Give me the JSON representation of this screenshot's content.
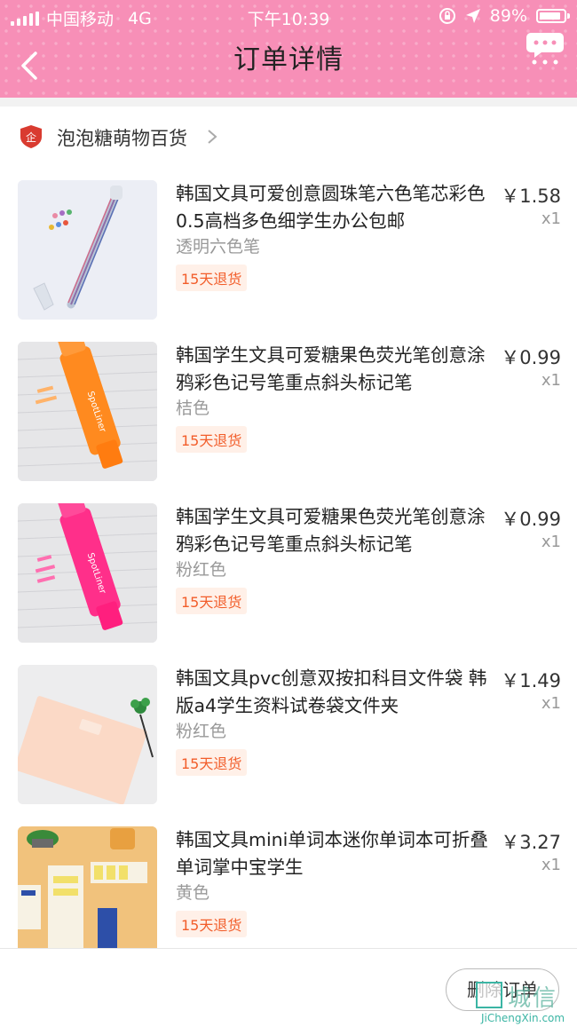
{
  "status_bar": {
    "carrier": "中国移动",
    "network": "4G",
    "time": "下午10:39",
    "battery": "89%",
    "battery_level": 0.89
  },
  "nav": {
    "title": "订单详情",
    "back_icon": "chevron-left-icon",
    "more_icon": "chat-bubble-more-icon"
  },
  "shop": {
    "name": "泡泡糖萌物百货",
    "icon": "shop-shield-icon"
  },
  "items": [
    {
      "title": "韩国文具可爱创意圆珠笔六色笔芯彩色0.5高档多色细学生办公包邮",
      "sku": "透明六色笔",
      "tag": "15天退货",
      "price": "￥1.58",
      "qty": "x1"
    },
    {
      "title": "韩国学生文具可爱糖果色荧光笔创意涂鸦彩色记号笔重点斜头标记笔",
      "sku": "桔色",
      "tag": "15天退货",
      "price": "￥0.99",
      "qty": "x1"
    },
    {
      "title": "韩国学生文具可爱糖果色荧光笔创意涂鸦彩色记号笔重点斜头标记笔",
      "sku": "粉红色",
      "tag": "15天退货",
      "price": "￥0.99",
      "qty": "x1"
    },
    {
      "title": "韩国文具pvc创意双按扣科目文件袋 韩版a4学生资料试卷袋文件夹",
      "sku": "粉红色",
      "tag": "15天退货",
      "price": "￥1.49",
      "qty": "x1"
    },
    {
      "title": "韩国文具mini单词本迷你单词本可折叠单词掌中宝学生",
      "sku": "黄色",
      "tag": "15天退货",
      "price": "￥3.27",
      "qty": "x1"
    }
  ],
  "footer": {
    "delete_label": "删除订单"
  },
  "watermark": {
    "text": "城信",
    "url": "JiChengXin.com"
  },
  "colors": {
    "header_pink": "#f78fb7",
    "tag_orange": "#f25d2a",
    "tag_bg": "#fff0e8"
  }
}
